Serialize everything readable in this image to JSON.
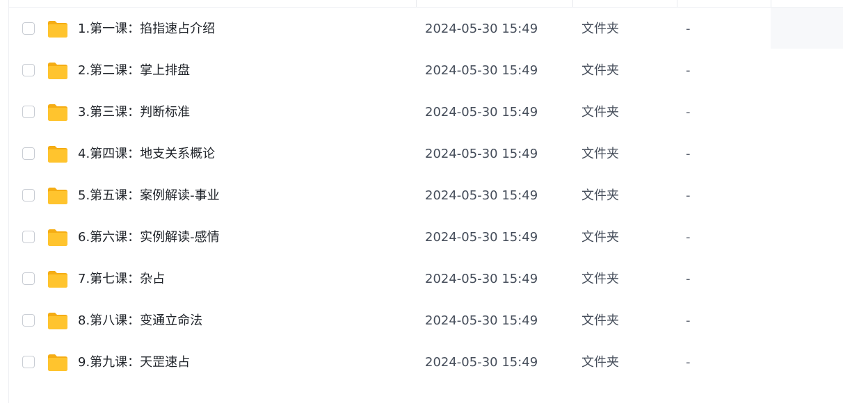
{
  "files": [
    {
      "name": "1.第一课：掐指速占介绍",
      "time": "2024-05-30 15:49",
      "type": "文件夹",
      "size": "-"
    },
    {
      "name": "2.第二课：掌上排盘",
      "time": "2024-05-30 15:49",
      "type": "文件夹",
      "size": "-"
    },
    {
      "name": "3.第三课：判断标准",
      "time": "2024-05-30 15:49",
      "type": "文件夹",
      "size": "-"
    },
    {
      "name": "4.第四课：地支关系概论",
      "time": "2024-05-30 15:49",
      "type": "文件夹",
      "size": "-"
    },
    {
      "name": "5.第五课：案例解读-事业",
      "time": "2024-05-30 15:49",
      "type": "文件夹",
      "size": "-"
    },
    {
      "name": "6.第六课：实例解读-感情",
      "time": "2024-05-30 15:49",
      "type": "文件夹",
      "size": "-"
    },
    {
      "name": "7.第七课：杂占",
      "time": "2024-05-30 15:49",
      "type": "文件夹",
      "size": "-"
    },
    {
      "name": "8.第八课：变通立命法",
      "time": "2024-05-30 15:49",
      "type": "文件夹",
      "size": "-"
    },
    {
      "name": "9.第九课：天罡速占",
      "time": "2024-05-30 15:49",
      "type": "文件夹",
      "size": "-"
    }
  ],
  "icons": {
    "row_icon": "folder-icon"
  },
  "colors": {
    "folder": "#ffc42e",
    "folder_back": "#f5ad14"
  }
}
